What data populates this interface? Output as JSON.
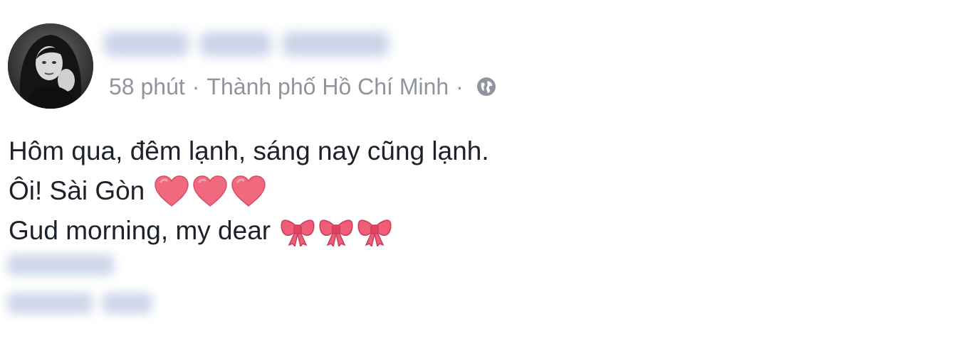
{
  "post": {
    "meta": {
      "time": "58 phút",
      "separator": "·",
      "location": "Thành phố Hồ Chí Minh",
      "privacy_icon": "globe-icon"
    },
    "lines": [
      {
        "text": "Hôm qua, đêm lạnh, sáng nay cũng lạnh.",
        "emoji": "",
        "emoji_count": 0
      },
      {
        "text": "Ôi! Sài Gòn",
        "emoji": "heart",
        "emoji_count": 3
      },
      {
        "text": "Gud morning, my dear",
        "emoji": "ribbon-bow",
        "emoji_count": 3
      }
    ]
  },
  "colors": {
    "meta_text": "#90949c",
    "body_text": "#1d2129",
    "heart": "#f1697f",
    "bow": "#ef5d78"
  }
}
